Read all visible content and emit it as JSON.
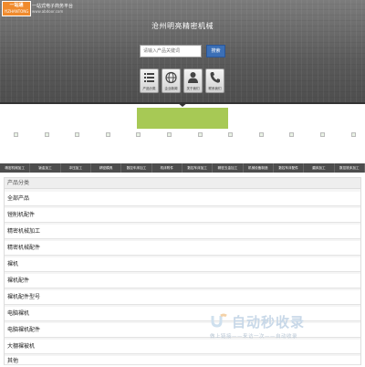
{
  "header": {
    "logo_text": "一站通",
    "logo_sub": "YIZHANTONG",
    "tagline": "一站式电子商务平台",
    "domain": "www.abdoor.com",
    "site_title": "沧州明亮精密机械",
    "search": {
      "placeholder": "请输入产品关键词",
      "button_label": "搜索"
    },
    "nav": [
      {
        "label": "产品分类",
        "icon": "list-icon"
      },
      {
        "label": "企业新闻",
        "icon": "globe-icon"
      },
      {
        "label": "关于我们",
        "icon": "person-icon"
      },
      {
        "label": "联系我们",
        "icon": "phone-icon"
      }
    ]
  },
  "categories": [
    "精密机械加工",
    "钣金加工",
    "冲压加工",
    "精密模具",
    "数控车床加工",
    "机床附件",
    "数控车床加工",
    "精密五金加工",
    "机械设备制造",
    "数控车床配件",
    "磨床加工",
    "数控铣床加工"
  ],
  "product_list": {
    "heading": "产品分类",
    "items": [
      "全部产品",
      "镗削机配件",
      "精密机械加工",
      "精密机械配件",
      "裸机",
      "裸机配件",
      "裸机配件型号",
      "电脑裸机",
      "电脑裸机配件",
      "大棚裸被机",
      "其他"
    ]
  },
  "watermark": {
    "title": "自动秒收录",
    "subtitle": "做上链接——来访一次——自动收录"
  }
}
